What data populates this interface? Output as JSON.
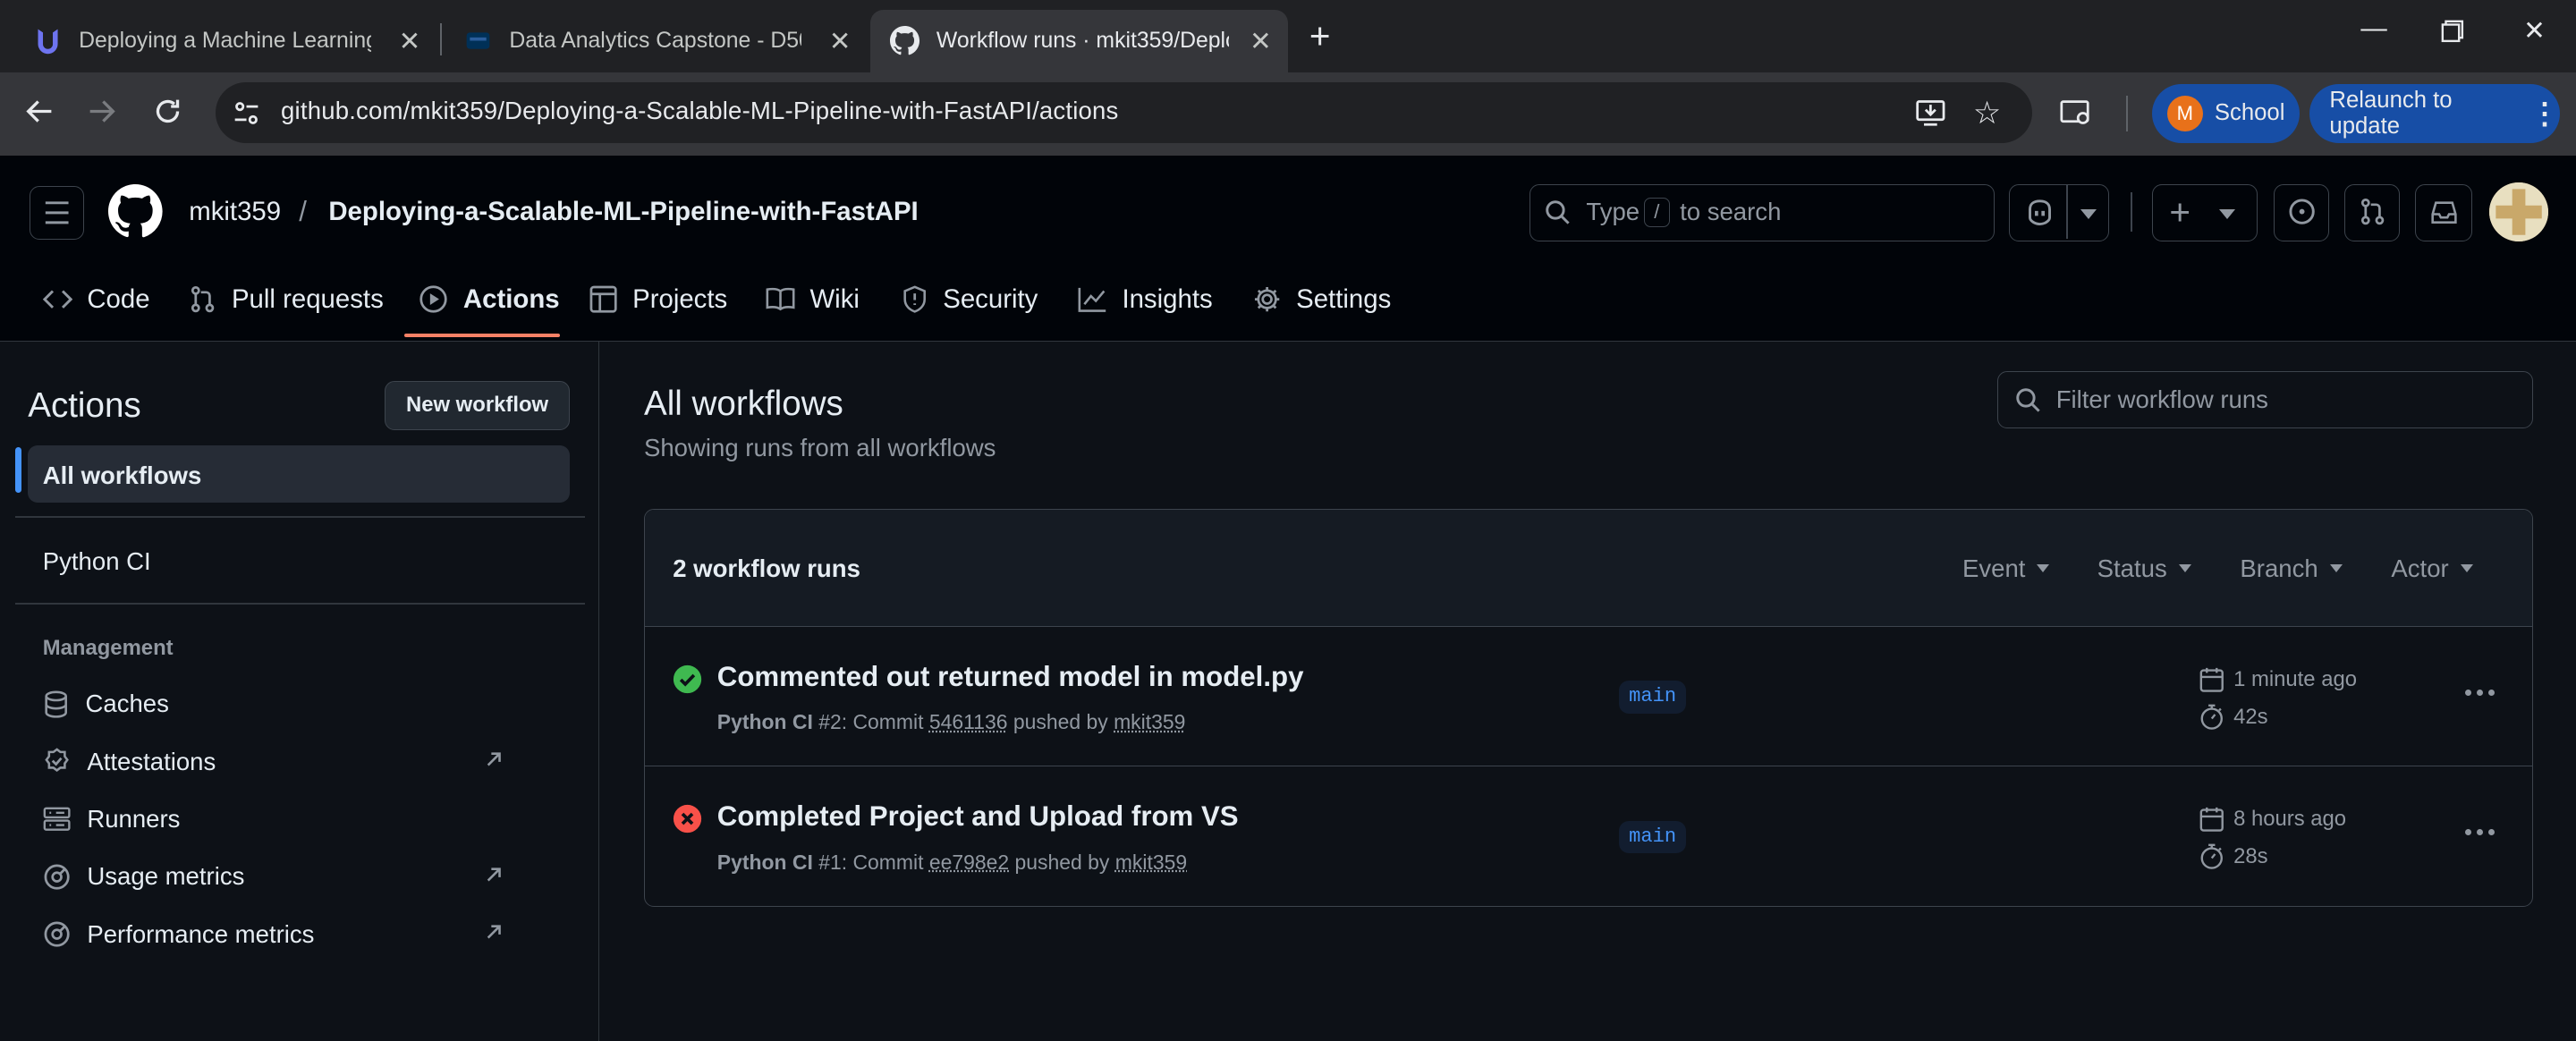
{
  "browser": {
    "tabs": [
      {
        "title": "Deploying a Machine Learning M",
        "icon": "udacity-icon"
      },
      {
        "title": "Data Analytics Capstone - D502",
        "icon": "wgu-icon"
      },
      {
        "title": "Workflow runs · mkit359/Deploy",
        "icon": "github-icon"
      }
    ],
    "url": "github.com/mkit359/Deploying-a-Scalable-ML-Pipeline-with-FastAPI/actions",
    "profile_initial": "M",
    "profile_label": "School",
    "relaunch_label": "Relaunch to update"
  },
  "header": {
    "owner": "mkit359",
    "separator": "/",
    "repo": "Deploying-a-Scalable-ML-Pipeline-with-FastAPI",
    "search_prefix": "Type",
    "search_key": "/",
    "search_suffix": "to search"
  },
  "repo_nav": [
    {
      "label": "Code",
      "icon": "code-icon"
    },
    {
      "label": "Pull requests",
      "icon": "pull-request-icon"
    },
    {
      "label": "Actions",
      "icon": "play-icon",
      "selected": true
    },
    {
      "label": "Projects",
      "icon": "table-icon"
    },
    {
      "label": "Wiki",
      "icon": "book-icon"
    },
    {
      "label": "Security",
      "icon": "shield-icon"
    },
    {
      "label": "Insights",
      "icon": "graph-icon"
    },
    {
      "label": "Settings",
      "icon": "gear-icon"
    }
  ],
  "sidebar": {
    "title": "Actions",
    "new_workflow": "New workflow",
    "all_workflows": "All workflows",
    "workflows": [
      "Python CI"
    ],
    "management_heading": "Management",
    "management_items": [
      {
        "label": "Caches",
        "icon": "database-icon",
        "external": false
      },
      {
        "label": "Attestations",
        "icon": "verified-icon",
        "external": true
      },
      {
        "label": "Runners",
        "icon": "server-icon",
        "external": false
      },
      {
        "label": "Usage metrics",
        "icon": "meter-icon",
        "external": true
      },
      {
        "label": "Performance metrics",
        "icon": "meter-icon",
        "external": true
      }
    ]
  },
  "main": {
    "title": "All workflows",
    "subtitle": "Showing runs from all workflows",
    "filter_placeholder": "Filter workflow runs",
    "runs_count": "2 workflow runs",
    "filters": [
      "Event",
      "Status",
      "Branch",
      "Actor"
    ],
    "runs": [
      {
        "status": "success",
        "title": "Commented out returned model in model.py",
        "workflow": "Python CI",
        "run": "#2: Commit",
        "commit": "5461136",
        "pushed_by": "pushed by",
        "actor": "mkit359",
        "branch": "main",
        "time": "1 minute ago",
        "duration": "42s"
      },
      {
        "status": "failure",
        "title": "Completed Project and Upload from VS",
        "workflow": "Python CI",
        "run": "#1: Commit",
        "commit": "ee798e2",
        "pushed_by": "pushed by",
        "actor": "mkit359",
        "branch": "main",
        "time": "8 hours ago",
        "duration": "28s"
      }
    ]
  },
  "colors": {
    "success": "#3fb950",
    "failure": "#f85149",
    "accent": "#f78166",
    "link": "#4493f8"
  }
}
